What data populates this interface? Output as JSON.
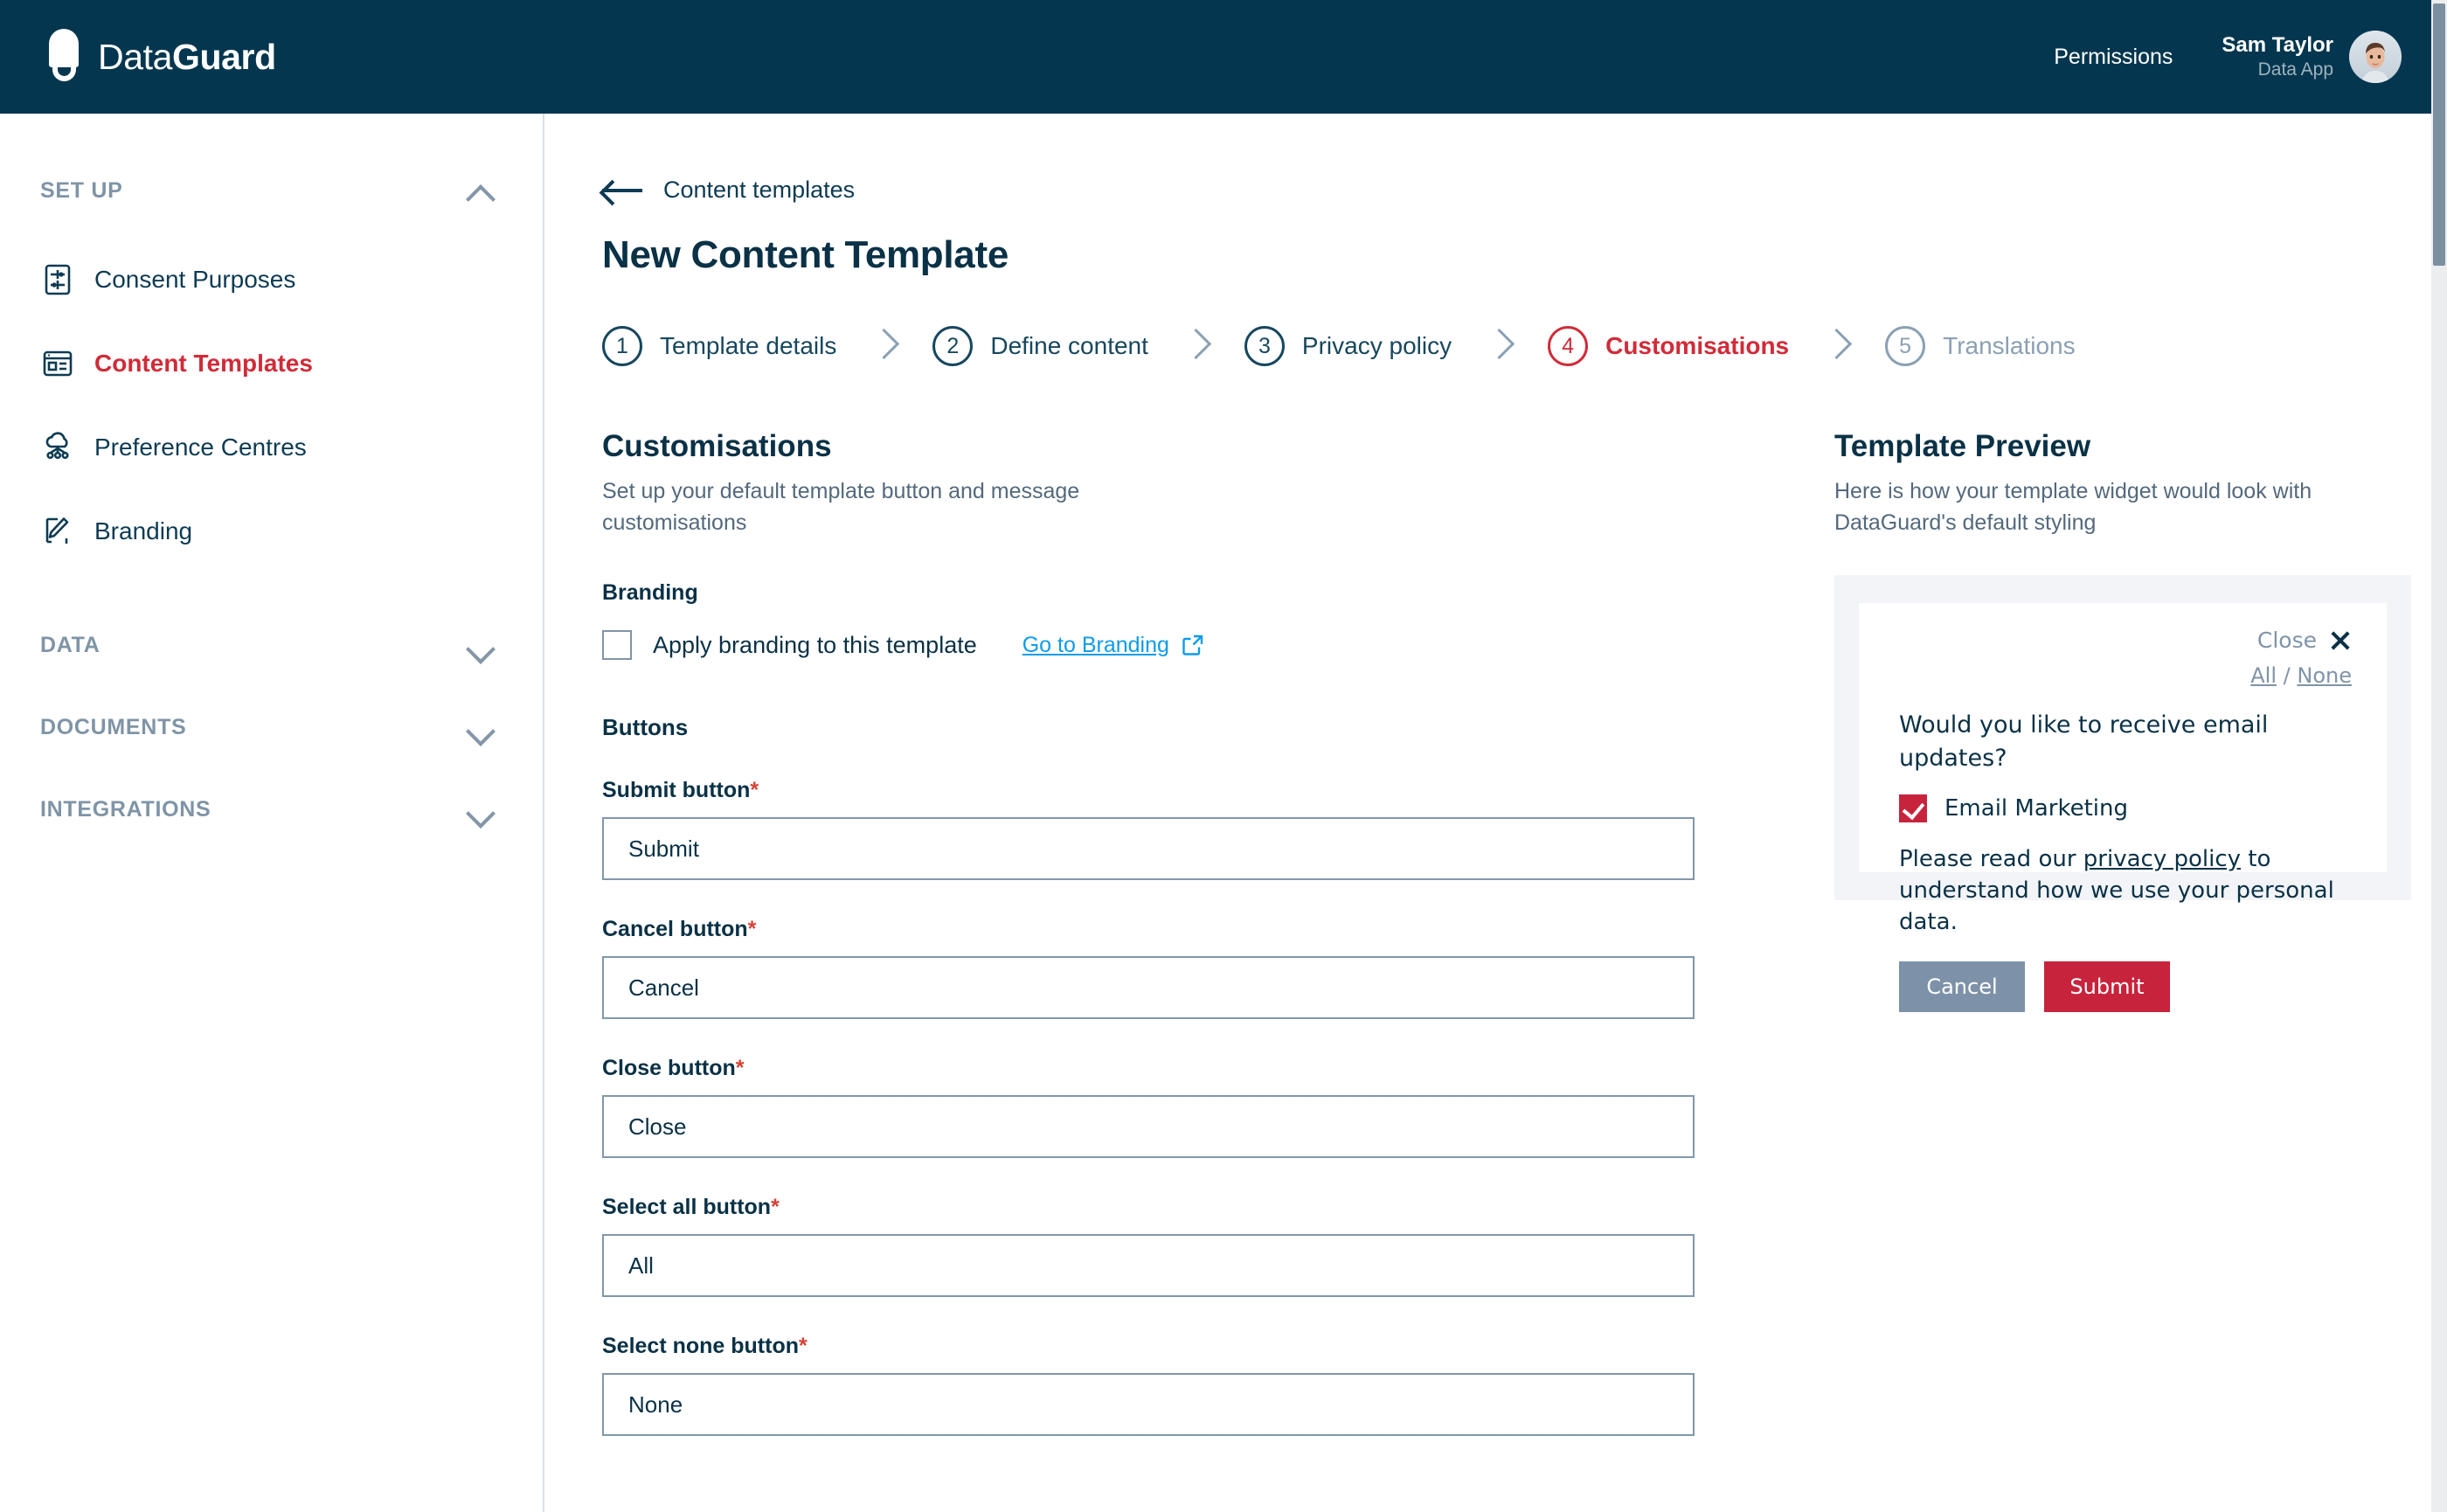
{
  "header": {
    "logo_text_light": "Data",
    "logo_text_bold": "Guard",
    "permissions_label": "Permissions",
    "user_name": "Sam Taylor",
    "user_role": "Data App"
  },
  "sidebar": {
    "sections": [
      {
        "title": "SET UP",
        "expanded": true,
        "items": [
          {
            "label": "Consent Purposes",
            "icon": "sliders-document-icon",
            "active": false
          },
          {
            "label": "Content Templates",
            "icon": "template-window-icon",
            "active": true
          },
          {
            "label": "Preference Centres",
            "icon": "cloud-network-icon",
            "active": false
          },
          {
            "label": "Branding",
            "icon": "brush-icon",
            "active": false
          }
        ]
      },
      {
        "title": "DATA",
        "expanded": false,
        "items": []
      },
      {
        "title": "DOCUMENTS",
        "expanded": false,
        "items": []
      },
      {
        "title": "INTEGRATIONS",
        "expanded": false,
        "items": []
      }
    ]
  },
  "main": {
    "breadcrumb": "Content templates",
    "page_title": "New Content Template",
    "steps": [
      {
        "num": "1",
        "label": "Template details",
        "state": "done"
      },
      {
        "num": "2",
        "label": "Define content",
        "state": "done"
      },
      {
        "num": "3",
        "label": "Privacy policy",
        "state": "done"
      },
      {
        "num": "4",
        "label": "Customisations",
        "state": "active"
      },
      {
        "num": "5",
        "label": "Translations",
        "state": "muted"
      }
    ],
    "customisations": {
      "title": "Customisations",
      "subtitle": "Set up your default template button and message customisations",
      "branding_group_label": "Branding",
      "apply_branding_label": "Apply branding to this template",
      "apply_branding_checked": false,
      "go_to_branding_label": "Go to Branding",
      "buttons_group_label": "Buttons",
      "fields": [
        {
          "label": "Submit button",
          "required": true,
          "value": "Submit"
        },
        {
          "label": "Cancel button",
          "required": true,
          "value": "Cancel"
        },
        {
          "label": "Close button",
          "required": true,
          "value": "Close"
        },
        {
          "label": "Select all button",
          "required": true,
          "value": "All"
        },
        {
          "label": "Select none button",
          "required": true,
          "value": "None"
        }
      ]
    },
    "preview": {
      "title": "Template Preview",
      "subtitle": "Here is how your template widget would look with DataGuard's default styling",
      "widget": {
        "close_label": "Close",
        "select_all_label": "All",
        "separator": "/",
        "select_none_label": "None",
        "question": "Would you like to receive email updates?",
        "purpose_label": "Email Marketing",
        "purpose_checked": true,
        "policy_prefix": "Please read our ",
        "policy_link": "privacy policy",
        "policy_suffix": " to understand how we use your personal data.",
        "cancel_label": "Cancel",
        "submit_label": "Submit"
      }
    }
  },
  "colors": {
    "header_bg": "#04374f",
    "accent_red": "#d02b38",
    "widget_red": "#c8233c",
    "link_blue": "#0e9ce8",
    "slate": "#7d92a8",
    "text_dark": "#0a3146"
  }
}
